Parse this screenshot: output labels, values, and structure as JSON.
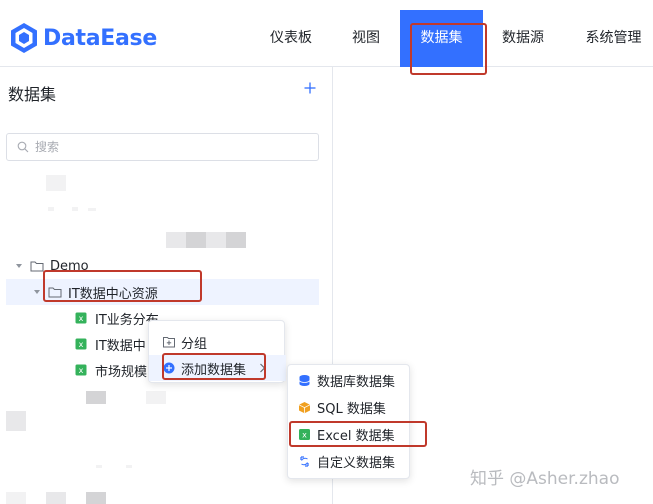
{
  "app": {
    "name": "DataEase",
    "brand_color": "#3370ff",
    "annotation_color": "#c0392b"
  },
  "nav": {
    "items": [
      {
        "label": "仪表板",
        "active": false
      },
      {
        "label": "视图",
        "active": false
      },
      {
        "label": "数据集",
        "active": true
      },
      {
        "label": "数据源",
        "active": false
      },
      {
        "label": "系统管理",
        "active": false
      }
    ]
  },
  "sidebar": {
    "title": "数据集",
    "add_icon": "plus-icon",
    "search": {
      "placeholder": "搜索",
      "value": ""
    },
    "tree": [
      {
        "label": "Demo",
        "type": "folder",
        "expanded": true
      },
      {
        "label": "IT数据中心资源",
        "type": "folder",
        "expanded": true
      },
      {
        "label": "IT业务分布",
        "type": "excel-dataset"
      },
      {
        "label": "IT数据中",
        "type": "excel-dataset"
      },
      {
        "label": "市场规模",
        "type": "excel-dataset"
      }
    ]
  },
  "context_menu": {
    "items": [
      {
        "label": "分组",
        "icon": "add-folder-icon"
      },
      {
        "label": "添加数据集",
        "icon": "plus-circle-icon",
        "has_submenu": true
      }
    ]
  },
  "submenu": {
    "items": [
      {
        "label": "数据库数据集",
        "icon": "database-icon",
        "color": "#3370ff"
      },
      {
        "label": "SQL 数据集",
        "icon": "sql-cube-icon",
        "color": "#f0a020"
      },
      {
        "label": "Excel 数据集",
        "icon": "excel-icon",
        "color": "#34b25b"
      },
      {
        "label": "自定义数据集",
        "icon": "custom-dataset-icon",
        "color": "#3370ff"
      }
    ]
  },
  "watermark": "知乎 @Asher.zhao"
}
